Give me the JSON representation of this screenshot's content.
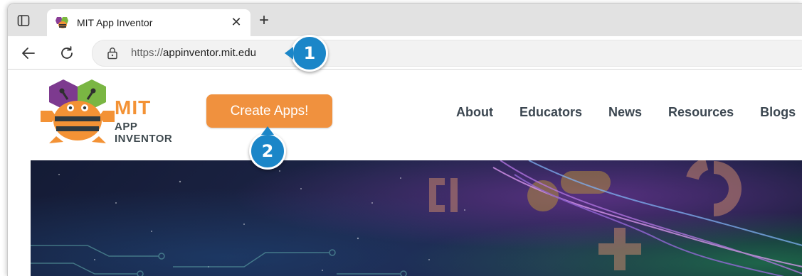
{
  "browser": {
    "tab": {
      "title": "MIT App Inventor",
      "close_glyph": "✕"
    },
    "new_tab_glyph": "+",
    "address": {
      "protocol": "https://",
      "host": "appinventor.mit.edu"
    }
  },
  "page": {
    "logo": {
      "line1": "MIT",
      "line2": "APP INVENTOR"
    },
    "cta_label": "Create Apps!",
    "nav": [
      "About",
      "Educators",
      "News",
      "Resources",
      "Blogs"
    ]
  },
  "callouts": {
    "one": "1",
    "two": "2"
  },
  "colors": {
    "accent_orange": "#f0913e",
    "badge_blue": "#1b86c8",
    "nav_text": "#3b4650"
  },
  "icons": [
    "sidebar-toggle-icon",
    "app-inventor-favicon",
    "close-icon",
    "plus-icon",
    "back-arrow-icon",
    "reload-icon",
    "lock-icon"
  ]
}
